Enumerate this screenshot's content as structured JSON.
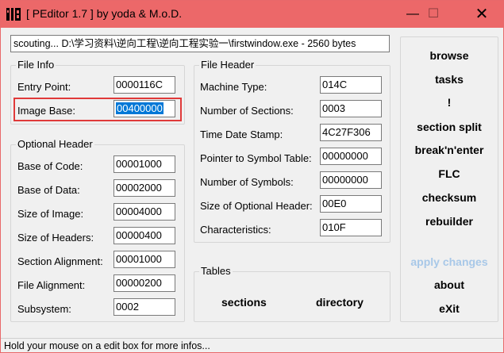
{
  "window": {
    "title": "[ PEditor 1.7 ]  by yoda & M.o.D.",
    "minimize_glyph": "—",
    "maximize_glyph": "☐",
    "close_glyph": "✕",
    "icons": {
      "app": "peditor-app-icon"
    }
  },
  "path": "scouting... D:\\学习资料\\逆向工程\\逆向工程实验一\\firstwindow.exe - 2560 bytes",
  "file_info": {
    "title": "File Info",
    "entry_point_label": "Entry Point:",
    "entry_point_value": "0000116C",
    "image_base_label": "Image Base:",
    "image_base_value": "00400000"
  },
  "optional_header": {
    "title": "Optional Header",
    "fields": [
      {
        "label": "Base of Code:",
        "value": "00001000"
      },
      {
        "label": "Base of Data:",
        "value": "00002000"
      },
      {
        "label": "Size of Image:",
        "value": "00004000"
      },
      {
        "label": "Size of Headers:",
        "value": "00000400"
      },
      {
        "label": "Section Alignment:",
        "value": "00001000"
      },
      {
        "label": "File Alignment:",
        "value": "00000200"
      },
      {
        "label": "Subsystem:",
        "value": "0002"
      }
    ]
  },
  "file_header": {
    "title": "File Header",
    "fields": [
      {
        "label": "Machine Type:",
        "value": "014C"
      },
      {
        "label": "Number of Sections:",
        "value": "0003"
      },
      {
        "label": "Time Date Stamp:",
        "value": "4C27F306"
      },
      {
        "label": "Pointer to Symbol Table:",
        "value": "00000000"
      },
      {
        "label": "Number of Symbols:",
        "value": "00000000"
      },
      {
        "label": "Size of Optional Header:",
        "value": "00E0"
      },
      {
        "label": "Characteristics:",
        "value": "010F"
      }
    ]
  },
  "tables": {
    "title": "Tables",
    "sections_label": "sections",
    "directory_label": "directory"
  },
  "sidebar": {
    "browse": "browse",
    "tasks": "tasks",
    "bang": "!",
    "section_split": "section split",
    "break_n_enter": "break'n'enter",
    "flc": "FLC",
    "checksum": "checksum",
    "rebuilder": "rebuilder",
    "apply_changes": "apply changes",
    "about": "about",
    "exit": "eXit"
  },
  "status": "Hold your mouse on a edit box for more infos...",
  "colors": {
    "titlebar": "#ec6869",
    "highlight": "#e03a3a",
    "selection": "#0078d7",
    "disabled": "#a8c8e8"
  }
}
